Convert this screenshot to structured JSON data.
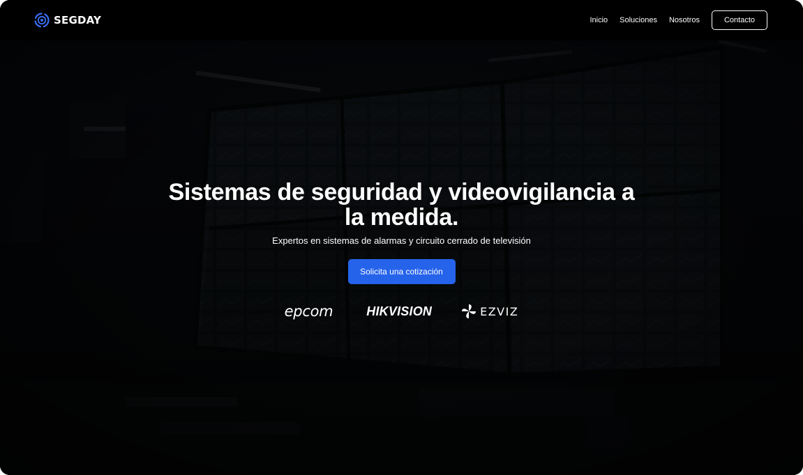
{
  "header": {
    "brand_name": "SEGDAY",
    "nav": {
      "inicio": "Inicio",
      "soluciones": "Soluciones",
      "nosotros": "Nosotros"
    },
    "contact_label": "Contacto"
  },
  "hero": {
    "title": "Sistemas de seguridad y videovigilancia a la medida.",
    "subtitle": "Expertos en sistemas de alarmas y circuito cerrado de televisión",
    "cta_label": "Solicita una cotización",
    "brands": {
      "epcom": "epcom",
      "hikvision": "HIKVISION",
      "ezviz": "EZVIZ"
    }
  },
  "colors": {
    "header_bg": "#000000",
    "accent": "#2563eb",
    "logo_blue": "#3b6ff5"
  },
  "icons": {
    "brand_logo": "segday-logo-icon",
    "ezviz_logo": "ezviz-logo-icon"
  }
}
